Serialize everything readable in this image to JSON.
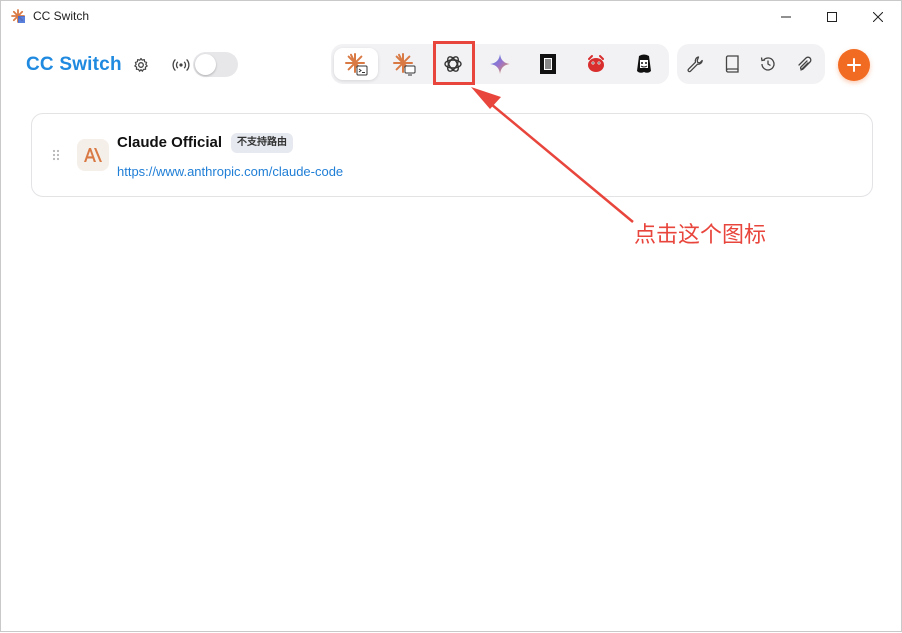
{
  "window": {
    "title": "CC Switch",
    "app_icon": "sparkle-app-icon"
  },
  "header": {
    "logo": "CC Switch",
    "settings_icon": "gear-icon",
    "proxy_icon": "signal-icon",
    "proxy_toggle_on": false
  },
  "app_tabs": [
    {
      "name": "claude-code",
      "icon": "claude-terminal-icon",
      "active": true
    },
    {
      "name": "claude-desktop",
      "icon": "claude-desktop-icon",
      "active": false
    },
    {
      "name": "codex",
      "icon": "openai-icon",
      "active": false,
      "highlighted": true
    },
    {
      "name": "gemini",
      "icon": "gemini-icon",
      "active": false
    },
    {
      "name": "opencode",
      "icon": "opencode-icon",
      "active": false
    },
    {
      "name": "red-app",
      "icon": "red-creature-icon",
      "active": false
    },
    {
      "name": "openclaw",
      "icon": "claw-icon",
      "active": false
    }
  ],
  "utilities": [
    {
      "name": "tools",
      "icon": "wrench-icon"
    },
    {
      "name": "docs",
      "icon": "book-icon"
    },
    {
      "name": "history",
      "icon": "history-icon"
    },
    {
      "name": "skills",
      "icon": "paperclip-icon"
    }
  ],
  "add_button": {
    "icon": "plus-icon"
  },
  "providers": [
    {
      "name": "Claude Official",
      "badge": "不支持路由",
      "url": "https://www.anthropic.com/claude-code"
    }
  ],
  "annotation": {
    "text": "点击这个图标",
    "color": "#e8453c"
  },
  "colors": {
    "accent": "#1f8ae0",
    "add_button": "#f26b22",
    "link": "#1f7ed6"
  }
}
